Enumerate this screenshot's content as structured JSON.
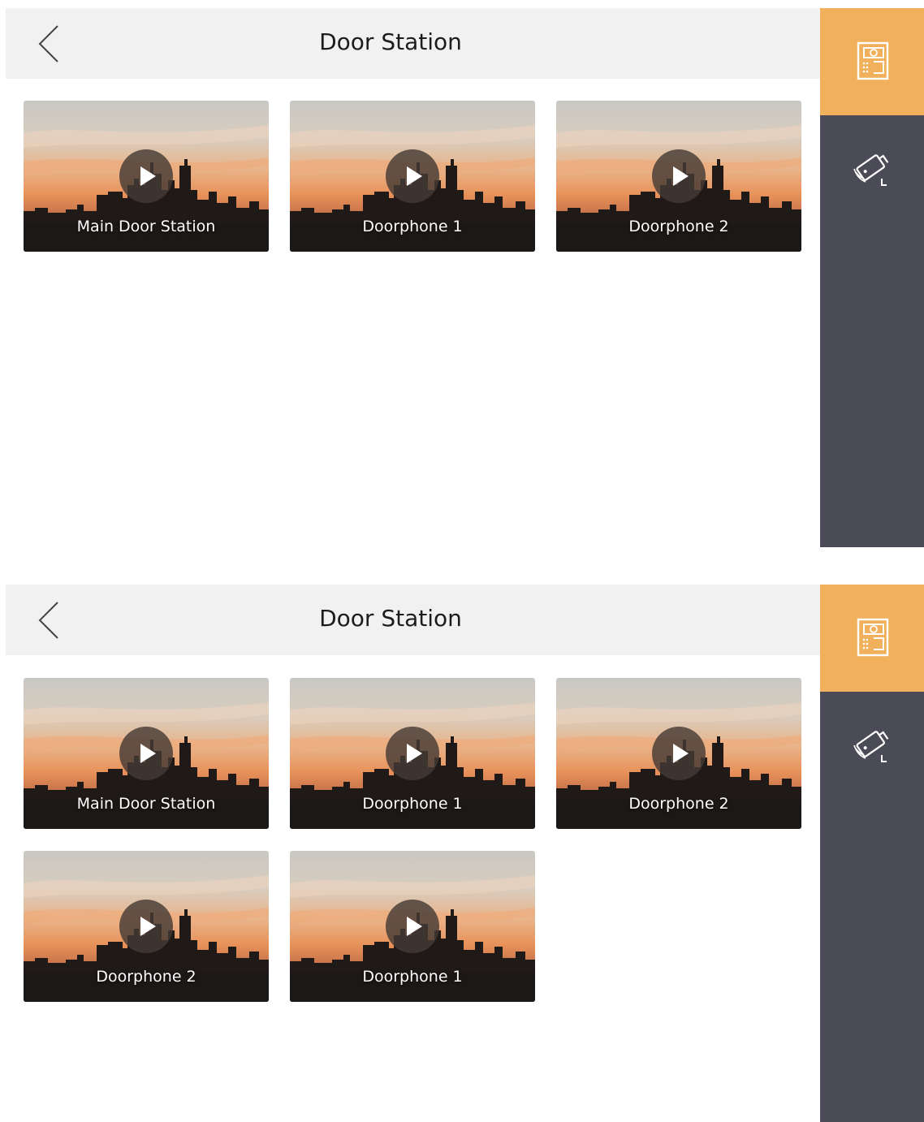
{
  "screens": [
    {
      "title": "Door Station",
      "tiles": [
        {
          "label": "Main Door Station"
        },
        {
          "label": "Doorphone 1"
        },
        {
          "label": "Doorphone 2"
        }
      ]
    },
    {
      "title": "Door Station",
      "tiles": [
        {
          "label": "Main Door Station"
        },
        {
          "label": "Doorphone 1"
        },
        {
          "label": "Doorphone 2"
        },
        {
          "label": "Doorphone 2"
        },
        {
          "label": "Doorphone 1"
        }
      ]
    }
  ],
  "sidebar": {
    "items": [
      {
        "icon": "door-station-icon",
        "active": true
      },
      {
        "icon": "camera-icon",
        "active": false
      }
    ]
  },
  "colors": {
    "accent": "#f1b05c",
    "sidebar": "#4b4b57",
    "header": "#f1f1f1"
  }
}
